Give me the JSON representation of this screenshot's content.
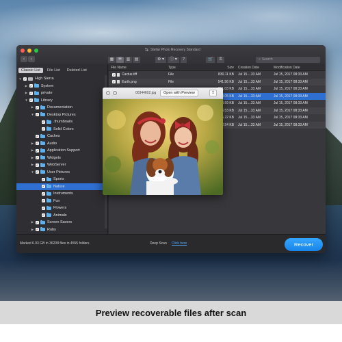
{
  "app": {
    "title": "Stellar Photo Recovery Standard"
  },
  "toolbar": {
    "back": "‹",
    "forward": "›",
    "view_icons": [
      "▦",
      "☰",
      "▥",
      "▤"
    ],
    "settings_icon": "⚙",
    "info_icon": "ⓘ",
    "help_label": "?",
    "search_placeholder": "Search"
  },
  "sidebar": {
    "tabs": [
      "Classic List",
      "File List",
      "Deleted List"
    ],
    "tree": [
      {
        "label": "High Sierra",
        "level": 0,
        "arrow": "▼",
        "checked": true,
        "kind": "drive"
      },
      {
        "label": "System",
        "level": 1,
        "arrow": "▶",
        "checked": true,
        "kind": "folder"
      },
      {
        "label": "private",
        "level": 1,
        "arrow": "▶",
        "checked": true,
        "kind": "folder"
      },
      {
        "label": "Library",
        "level": 1,
        "arrow": "▼",
        "checked": true,
        "kind": "folder"
      },
      {
        "label": "Documentation",
        "level": 2,
        "arrow": "▶",
        "checked": true,
        "kind": "folder"
      },
      {
        "label": "Desktop Pictures",
        "level": 2,
        "arrow": "▼",
        "checked": true,
        "kind": "folder"
      },
      {
        "label": ".thumbnails",
        "level": 3,
        "arrow": "",
        "checked": true,
        "kind": "folder"
      },
      {
        "label": "Solid Colors",
        "level": 3,
        "arrow": "",
        "checked": true,
        "kind": "folder"
      },
      {
        "label": "Caches",
        "level": 2,
        "arrow": "",
        "checked": true,
        "kind": "folder"
      },
      {
        "label": "Audio",
        "level": 2,
        "arrow": "▶",
        "checked": true,
        "kind": "folder"
      },
      {
        "label": "Application Support",
        "level": 2,
        "arrow": "▶",
        "checked": true,
        "kind": "folder"
      },
      {
        "label": "Widgets",
        "level": 2,
        "arrow": "▶",
        "checked": true,
        "kind": "folder"
      },
      {
        "label": "WebServer",
        "level": 2,
        "arrow": "▶",
        "checked": true,
        "kind": "folder"
      },
      {
        "label": "User Pictures",
        "level": 2,
        "arrow": "▼",
        "checked": true,
        "kind": "folder"
      },
      {
        "label": "Sports",
        "level": 3,
        "arrow": "",
        "checked": true,
        "kind": "folder"
      },
      {
        "label": "Nature",
        "level": 3,
        "arrow": "",
        "checked": true,
        "kind": "folder",
        "selected": true
      },
      {
        "label": "Instruments",
        "level": 3,
        "arrow": "",
        "checked": true,
        "kind": "folder"
      },
      {
        "label": "Fun",
        "level": 3,
        "arrow": "",
        "checked": true,
        "kind": "folder"
      },
      {
        "label": "Flowers",
        "level": 3,
        "arrow": "",
        "checked": true,
        "kind": "folder"
      },
      {
        "label": "Animals",
        "level": 3,
        "arrow": "",
        "checked": true,
        "kind": "folder"
      },
      {
        "label": "Screen Savers",
        "level": 2,
        "arrow": "▶",
        "checked": true,
        "kind": "folder"
      },
      {
        "label": "Ruby",
        "level": 2,
        "arrow": "▶",
        "checked": true,
        "kind": "folder"
      }
    ]
  },
  "filelist": {
    "headers": [
      "File Name",
      "Type",
      "Size",
      "Creation Date",
      "Modification Date"
    ],
    "rows": [
      {
        "name": "Cactus.tiff",
        "type": "File",
        "size": "830.11 KB",
        "created": "Jul 15....33 AM",
        "modified": "Jul 15, 2017 08:33 AM"
      },
      {
        "name": "Earth.png",
        "type": "File",
        "size": "541.56 KB",
        "created": "Jul 15....33 AM",
        "modified": "Jul 15, 2017 08:33 AM"
      },
      {
        "name": "",
        "type": "",
        "size": "351.03 KB",
        "created": "Jul 15....33 AM",
        "modified": "Jul 15, 2017 08:33 AM"
      },
      {
        "name": "",
        "type": "",
        "size": "240.05 KB",
        "created": "Jul 15....33 AM",
        "modified": "Jul 15, 2017 08:33 AM",
        "selected": true
      },
      {
        "name": "",
        "type": "",
        "size": "723.59 KB",
        "created": "Jul 15....33 AM",
        "modified": "Jul 15, 2017 08:33 AM"
      },
      {
        "name": "",
        "type": "",
        "size": "776.53 KB",
        "created": "Jul 15....33 AM",
        "modified": "Jul 15, 2017 08:33 AM"
      },
      {
        "name": "",
        "type": "",
        "size": "725.22 KB",
        "created": "Jul 15....33 AM",
        "modified": "Jul 15, 2017 08:33 AM"
      },
      {
        "name": "",
        "type": "",
        "size": "712.54 KB",
        "created": "Jul 15....33 AM",
        "modified": "Jul 15, 2017 08:33 AM"
      }
    ]
  },
  "preview": {
    "filename": "00344602.jpg",
    "open_label": "Open with Preview",
    "share_icon": "⇪"
  },
  "status": {
    "summary": "Marked 6.03 GB in 36208 files in 4555 folders",
    "deep_scan": "Deep Scan",
    "click_here": "Click here",
    "recover_label": "Recover"
  },
  "caption": "Preview recoverable files after scan"
}
